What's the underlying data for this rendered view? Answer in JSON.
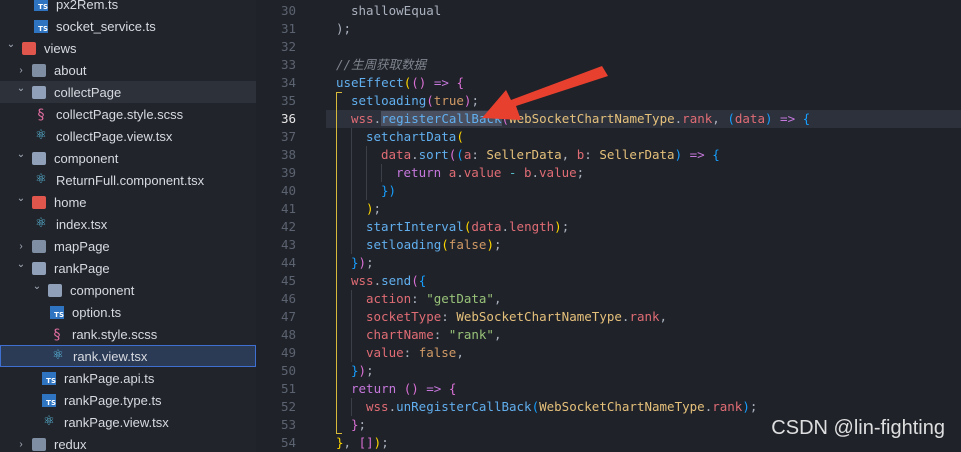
{
  "explorer": {
    "items": [
      {
        "label": "px2Rem.ts",
        "kind": "ts"
      },
      {
        "label": "socket_service.ts",
        "kind": "ts"
      },
      {
        "label": "views",
        "kind": "folder-red-open",
        "chevron": "down"
      },
      {
        "label": "about",
        "kind": "folder",
        "chevron": "right"
      },
      {
        "label": "collectPage",
        "kind": "folder-open",
        "chevron": "down"
      },
      {
        "label": "collectPage.style.scss",
        "kind": "sass"
      },
      {
        "label": "collectPage.view.tsx",
        "kind": "react"
      },
      {
        "label": "component",
        "kind": "folder-open",
        "chevron": "down"
      },
      {
        "label": "ReturnFull.component.tsx",
        "kind": "react"
      },
      {
        "label": "home",
        "kind": "folder-red-open",
        "chevron": "down"
      },
      {
        "label": "index.tsx",
        "kind": "react"
      },
      {
        "label": "mapPage",
        "kind": "folder",
        "chevron": "right"
      },
      {
        "label": "rankPage",
        "kind": "folder-open",
        "chevron": "down"
      },
      {
        "label": "component",
        "kind": "folder-open",
        "chevron": "down"
      },
      {
        "label": "option.ts",
        "kind": "ts"
      },
      {
        "label": "rank.style.scss",
        "kind": "sass"
      },
      {
        "label": "rank.view.tsx",
        "kind": "react"
      },
      {
        "label": "rankPage.api.ts",
        "kind": "ts"
      },
      {
        "label": "rankPage.type.ts",
        "kind": "ts"
      },
      {
        "label": "rankPage.view.tsx",
        "kind": "react"
      },
      {
        "label": "redux",
        "kind": "folder",
        "chevron": "right"
      }
    ]
  },
  "icons": {
    "chevron_down": "⌄",
    "chevron_right": "›",
    "react": "⚛",
    "sass": "§",
    "ts_badge": "TS"
  },
  "editor": {
    "line_numbers": [
      "30",
      "31",
      "32",
      "33",
      "34",
      "35",
      "36",
      "37",
      "38",
      "39",
      "40",
      "41",
      "42",
      "43",
      "44",
      "45",
      "46",
      "47",
      "48",
      "49",
      "50",
      "51",
      "52",
      "53",
      "54"
    ],
    "current_line": "36",
    "lines": {
      "l30_a": "shallowEqual",
      "l31_a": ");",
      "l33_comment": "//生周获取数据",
      "l34_fn": "useEffect",
      "l35_fn": "setloading",
      "l35_arg": "true",
      "l36_obj": "wss",
      "l36_fn": "registerCallBack",
      "l36_type": "WebSocketChartNameType",
      "l36_prop": "rank",
      "l36_param": "data",
      "l37_fn": "setchartData",
      "l38_obj": "data",
      "l38_fn": "sort",
      "l38_a": "a",
      "l38_type": "SellerData",
      "l38_b": "b",
      "l39_kw": "return",
      "l39_a": "a",
      "l39_value": "value",
      "l39_b": "b",
      "l42_fn": "startInterval",
      "l42_obj": "data",
      "l42_prop": "length",
      "l43_fn": "setloading",
      "l43_arg": "false",
      "l45_obj": "wss",
      "l45_fn": "send",
      "l46_key": "action",
      "l46_val": "\"getData\"",
      "l47_key": "socketType",
      "l47_type": "WebSocketChartNameType",
      "l47_prop": "rank",
      "l48_key": "chartName",
      "l48_val": "\"rank\"",
      "l49_key": "value",
      "l49_val": "false",
      "l51_kw": "return",
      "l52_obj": "wss",
      "l52_fn": "unRegisterCallBack",
      "l52_type": "WebSocketChartNameType",
      "l52_prop": "rank"
    }
  },
  "annotation": {
    "color": "#e8402f"
  },
  "watermark": "CSDN @lin-fighting"
}
